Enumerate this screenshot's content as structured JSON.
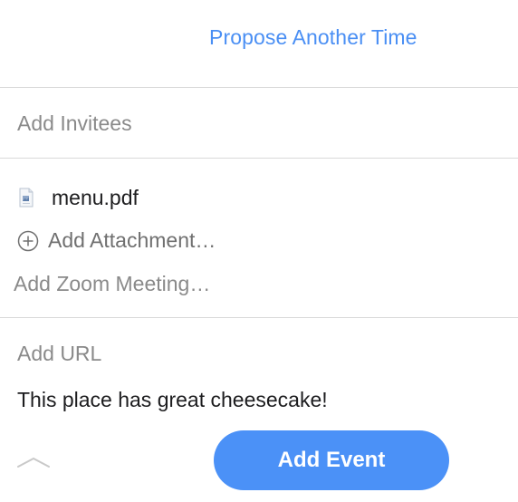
{
  "header": {
    "propose_label": "Propose Another Time"
  },
  "invitees": {
    "placeholder": "Add Invitees"
  },
  "attachments": {
    "files": [
      {
        "name": "menu.pdf",
        "icon": "pdf-file-icon"
      }
    ],
    "add_label": "Add Attachment…"
  },
  "zoom": {
    "label": "Add Zoom Meeting…"
  },
  "url": {
    "placeholder": "Add URL"
  },
  "notes": {
    "text": "This place has great cheesecake!"
  },
  "footer": {
    "collapse_icon": "chevron-up-icon",
    "add_event_label": "Add Event"
  },
  "colors": {
    "accent": "#4b91f7",
    "link": "#4a8ff4",
    "placeholder": "#8a8a8a",
    "divider": "#d9d9d9"
  }
}
